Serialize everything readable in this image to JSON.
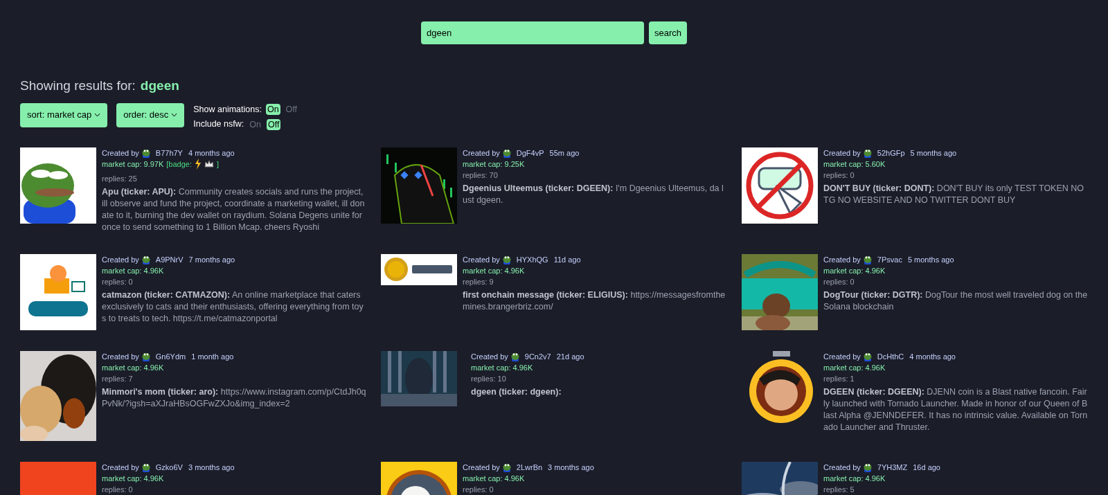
{
  "search": {
    "value": "dgeen",
    "button": "search"
  },
  "results_header": {
    "label": "Showing results for:",
    "query": "dgeen"
  },
  "dropdowns": [
    {
      "label": "sort: market cap"
    },
    {
      "label": "order: desc"
    }
  ],
  "toggles": [
    {
      "label": "Show animations:",
      "options": [
        {
          "label": "On",
          "selected": true
        },
        {
          "label": "Off",
          "selected": false
        }
      ]
    },
    {
      "label": "Include nsfw:",
      "options": [
        {
          "label": "On",
          "selected": false
        },
        {
          "label": "Off",
          "selected": true
        }
      ]
    }
  ],
  "cards": [
    {
      "created_label": "Created by",
      "user": "B77h7Y",
      "time": "4 months ago",
      "market_cap": "market cap: 9.97K",
      "badge": {
        "prefix": "[badge:",
        "suffix": "]"
      },
      "replies": "replies: 25",
      "name": "Apu (ticker: APU):",
      "description": "Community creates socials and runs the project, ill observe and fund the project, coordinate a marketing wallet, ill donate to it, burning the dev wallet on raydium. Solana Degens unite for once to send something to 1 Billion Mcap. cheers Ryoshi"
    },
    {
      "created_label": "Created by",
      "user": "DgF4vP",
      "time": "55m ago",
      "market_cap": "market cap: 9.25K",
      "replies": "replies: 70",
      "name": "Dgeenius Ulteemus (ticker: DGEEN):",
      "description": "I'm Dgeenius Ulteemus, da lust dgeen."
    },
    {
      "created_label": "Created by",
      "user": "52hGFp",
      "time": "5 months ago",
      "market_cap": "market cap: 5.60K",
      "replies": "replies: 0",
      "name": "DON'T BUY (ticker: DONT):",
      "description": "DON'T BUY its only TEST TOKEN NO TG NO WEBSITE AND NO TWITTER DONT BUY"
    },
    {
      "created_label": "Created by",
      "user": "A9PNrV",
      "time": "7 months ago",
      "market_cap": "market cap: 4.96K",
      "replies": "replies: 0",
      "name": "catmazon (ticker: CATMAZON):",
      "description": "An online marketplace that caters exclusively to cats and their enthusiasts, offering everything from toys to treats to tech. https://t.me/catmazonportal"
    },
    {
      "created_label": "Created by",
      "user": "HYXhQG",
      "time": "11d ago",
      "market_cap": "market cap: 4.96K",
      "replies": "replies: 9",
      "name": "first onchain message (ticker: ELIGIUS):",
      "description": "https://messagesfromthemines.brangerbriz.com/"
    },
    {
      "created_label": "Created by",
      "user": "7Psvac",
      "time": "5 months ago",
      "market_cap": "market cap: 4.96K",
      "replies": "replies: 0",
      "name": "DogTour (ticker: DGTR):",
      "description": "DogTour the most well traveled dog on the Solana blockchain"
    },
    {
      "created_label": "Created by",
      "user": "Gn6Ydm",
      "time": "1 month ago",
      "market_cap": "market cap: 4.96K",
      "replies": "replies: 7",
      "name": "Minmori's mom (ticker: aro):",
      "description": "https://www.instagram.com/p/CtdJh0qPvNk/?igsh=aXJraHBsOGFwZXJo&img_index=2"
    },
    {
      "created_label": "Created by",
      "user": "9Cn2v7",
      "time": "21d ago",
      "market_cap": "market cap: 4.96K",
      "replies": "replies: 10",
      "name": "dgeen (ticker: dgeen):"
    },
    {
      "created_label": "Created by",
      "user": "DcHthC",
      "time": "4 months ago",
      "market_cap": "market cap: 4.96K",
      "replies": "replies: 1",
      "name": "DGEEN (ticker: DGEEN):",
      "description": "DJENN coin is a Blast native fancoin. Fairly launched with Tornado Launcher. Made in honor of our Queen of Blast Alpha @JENNDEFER. It has no intrinsic value. Available on Tornado Launcher and Thruster."
    },
    {
      "created_label": "Created by",
      "user": "Gzko6V",
      "time": "3 months ago",
      "market_cap": "market cap: 4.96K",
      "replies": "replies: 0"
    },
    {
      "created_label": "Created by",
      "user": "2LwrBn",
      "time": "3 months ago",
      "market_cap": "market cap: 4.96K",
      "replies": "replies: 0"
    },
    {
      "created_label": "Created by",
      "user": "7YH3MZ",
      "time": "16d ago",
      "market_cap": "market cap: 4.96K",
      "replies": "replies: 5"
    }
  ]
}
